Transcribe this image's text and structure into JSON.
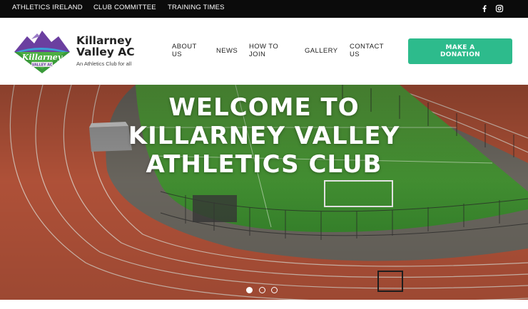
{
  "topbar": {
    "links": [
      "ATHLETICS IRELAND",
      "CLUB COMMITTEE",
      "TRAINING TIMES"
    ],
    "social": [
      "facebook-icon",
      "instagram-icon"
    ]
  },
  "brand": {
    "logo_text": "Killarney",
    "logo_badge": "VALLEY AC",
    "name": "Killarney Valley AC",
    "tagline": "An Athletics Club for all"
  },
  "nav": {
    "items": [
      {
        "label": "ABOUT US"
      },
      {
        "label": "NEWS"
      },
      {
        "label": "HOW TO JOIN"
      },
      {
        "label": "GALLERY"
      },
      {
        "label": "CONTACT US"
      }
    ],
    "cta": "MAKE A DONATION"
  },
  "hero": {
    "lines": [
      "WELCOME TO",
      "KILLARNEY VALLEY",
      "ATHLETICS CLUB"
    ],
    "slides": 3,
    "active_slide": 1
  },
  "colors": {
    "topbar": "#0b0b0b",
    "accent": "#2dbb8c",
    "logo_purple": "#6b3fa0",
    "logo_green": "#3a9a3a",
    "track": "#b8553b",
    "turf": "#3f9a36"
  }
}
